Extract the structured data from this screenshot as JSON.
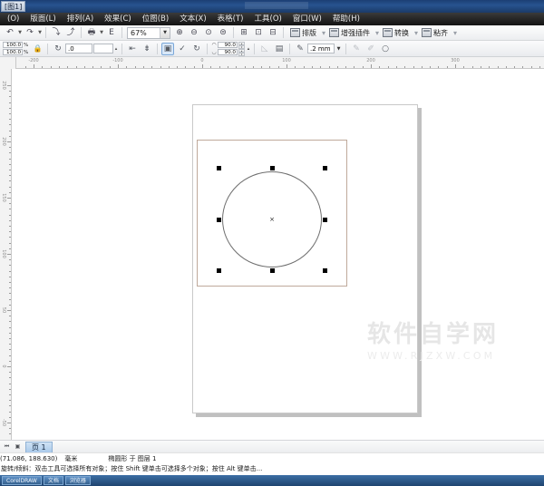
{
  "window": {
    "tab_title": "[图1]"
  },
  "menubar": {
    "items": [
      {
        "label": "(O)"
      },
      {
        "label": "版面(L)"
      },
      {
        "label": "排列(A)"
      },
      {
        "label": "效果(C)"
      },
      {
        "label": "位图(B)"
      },
      {
        "label": "文本(X)"
      },
      {
        "label": "表格(T)"
      },
      {
        "label": "工具(O)"
      },
      {
        "label": "窗口(W)"
      },
      {
        "label": "帮助(H)"
      }
    ]
  },
  "toolbar": {
    "undo_icon": "↶",
    "redo_icon": "↷",
    "import_icon": "⤵",
    "export_icon": "⤴",
    "print_icon": "🖶",
    "publish_icon": "E",
    "zoom_value": "67%",
    "zoom_caret": "▼",
    "zoom_in_icon": "⊕",
    "zoom_out_icon": "⊖",
    "zoom_fit_icon": "⊙",
    "zoom_all_icon": "⊜",
    "zoom_sel_icon": "⊞",
    "zoom_page_icon": "⊡",
    "plugin_buttons": [
      {
        "label": "排版"
      },
      {
        "label": "增强插件"
      },
      {
        "label": "转换"
      },
      {
        "label": "粘齐"
      }
    ]
  },
  "propertybar": {
    "scale_x": "100.0",
    "scale_y": "100.0",
    "scale_unit": "%",
    "lock_icon": "🔒",
    "rotate_icon": "↻",
    "rotate_value": ".0",
    "mirror_h_icon": "⇤",
    "mirror_v_icon": "⇟",
    "to_front_icon": "▣",
    "to_back_icon": "✓",
    "convert_icon": "↻",
    "corner_a": "90.0",
    "corner_b": "90.0",
    "wrap_icon": "▤",
    "outline_icon": "✎",
    "outline_width": ".2 mm",
    "outline_caret": "▼",
    "extra_1": "✎",
    "extra_2": "✐",
    "extra_3": "○"
  },
  "rulers": {
    "unit": "毫米",
    "h_labels": [
      "-200",
      "-100",
      "0",
      "100",
      "200",
      "300"
    ],
    "v_labels": [
      "250",
      "200",
      "150",
      "100",
      "50",
      "0",
      "-50"
    ]
  },
  "canvas": {
    "watermark_text": "软件自学网",
    "watermark_url": "WWW.RJZXW.COM",
    "selection_center_marker": "×"
  },
  "pagebar": {
    "first_icon": "⏮",
    "prev_icon": "◀",
    "add_icon": "▣",
    "page_label": "页 1"
  },
  "statusbar": {
    "coordinates": "(71.086, 188.630)",
    "unit": "毫米",
    "object_info": "椭圆形 于 图层 1",
    "hint": "旋转/倾斜：双击工具可选择所有对象；按住 Shift 键单击可选择多个对象；按住 Alt 键单击..."
  },
  "taskbar": {
    "tasks": [
      {
        "label": "CorelDRAW"
      },
      {
        "label": "文档"
      },
      {
        "label": "浏览器"
      }
    ]
  },
  "colors": {
    "title_blue": "#27538f",
    "menu_dark": "#262626",
    "page_white": "#ffffff",
    "inner_rect_border": "#bfa99b",
    "ellipse_stroke": "#6e6e6e",
    "handle": "#000000",
    "watermark": "#e6e6e6"
  }
}
